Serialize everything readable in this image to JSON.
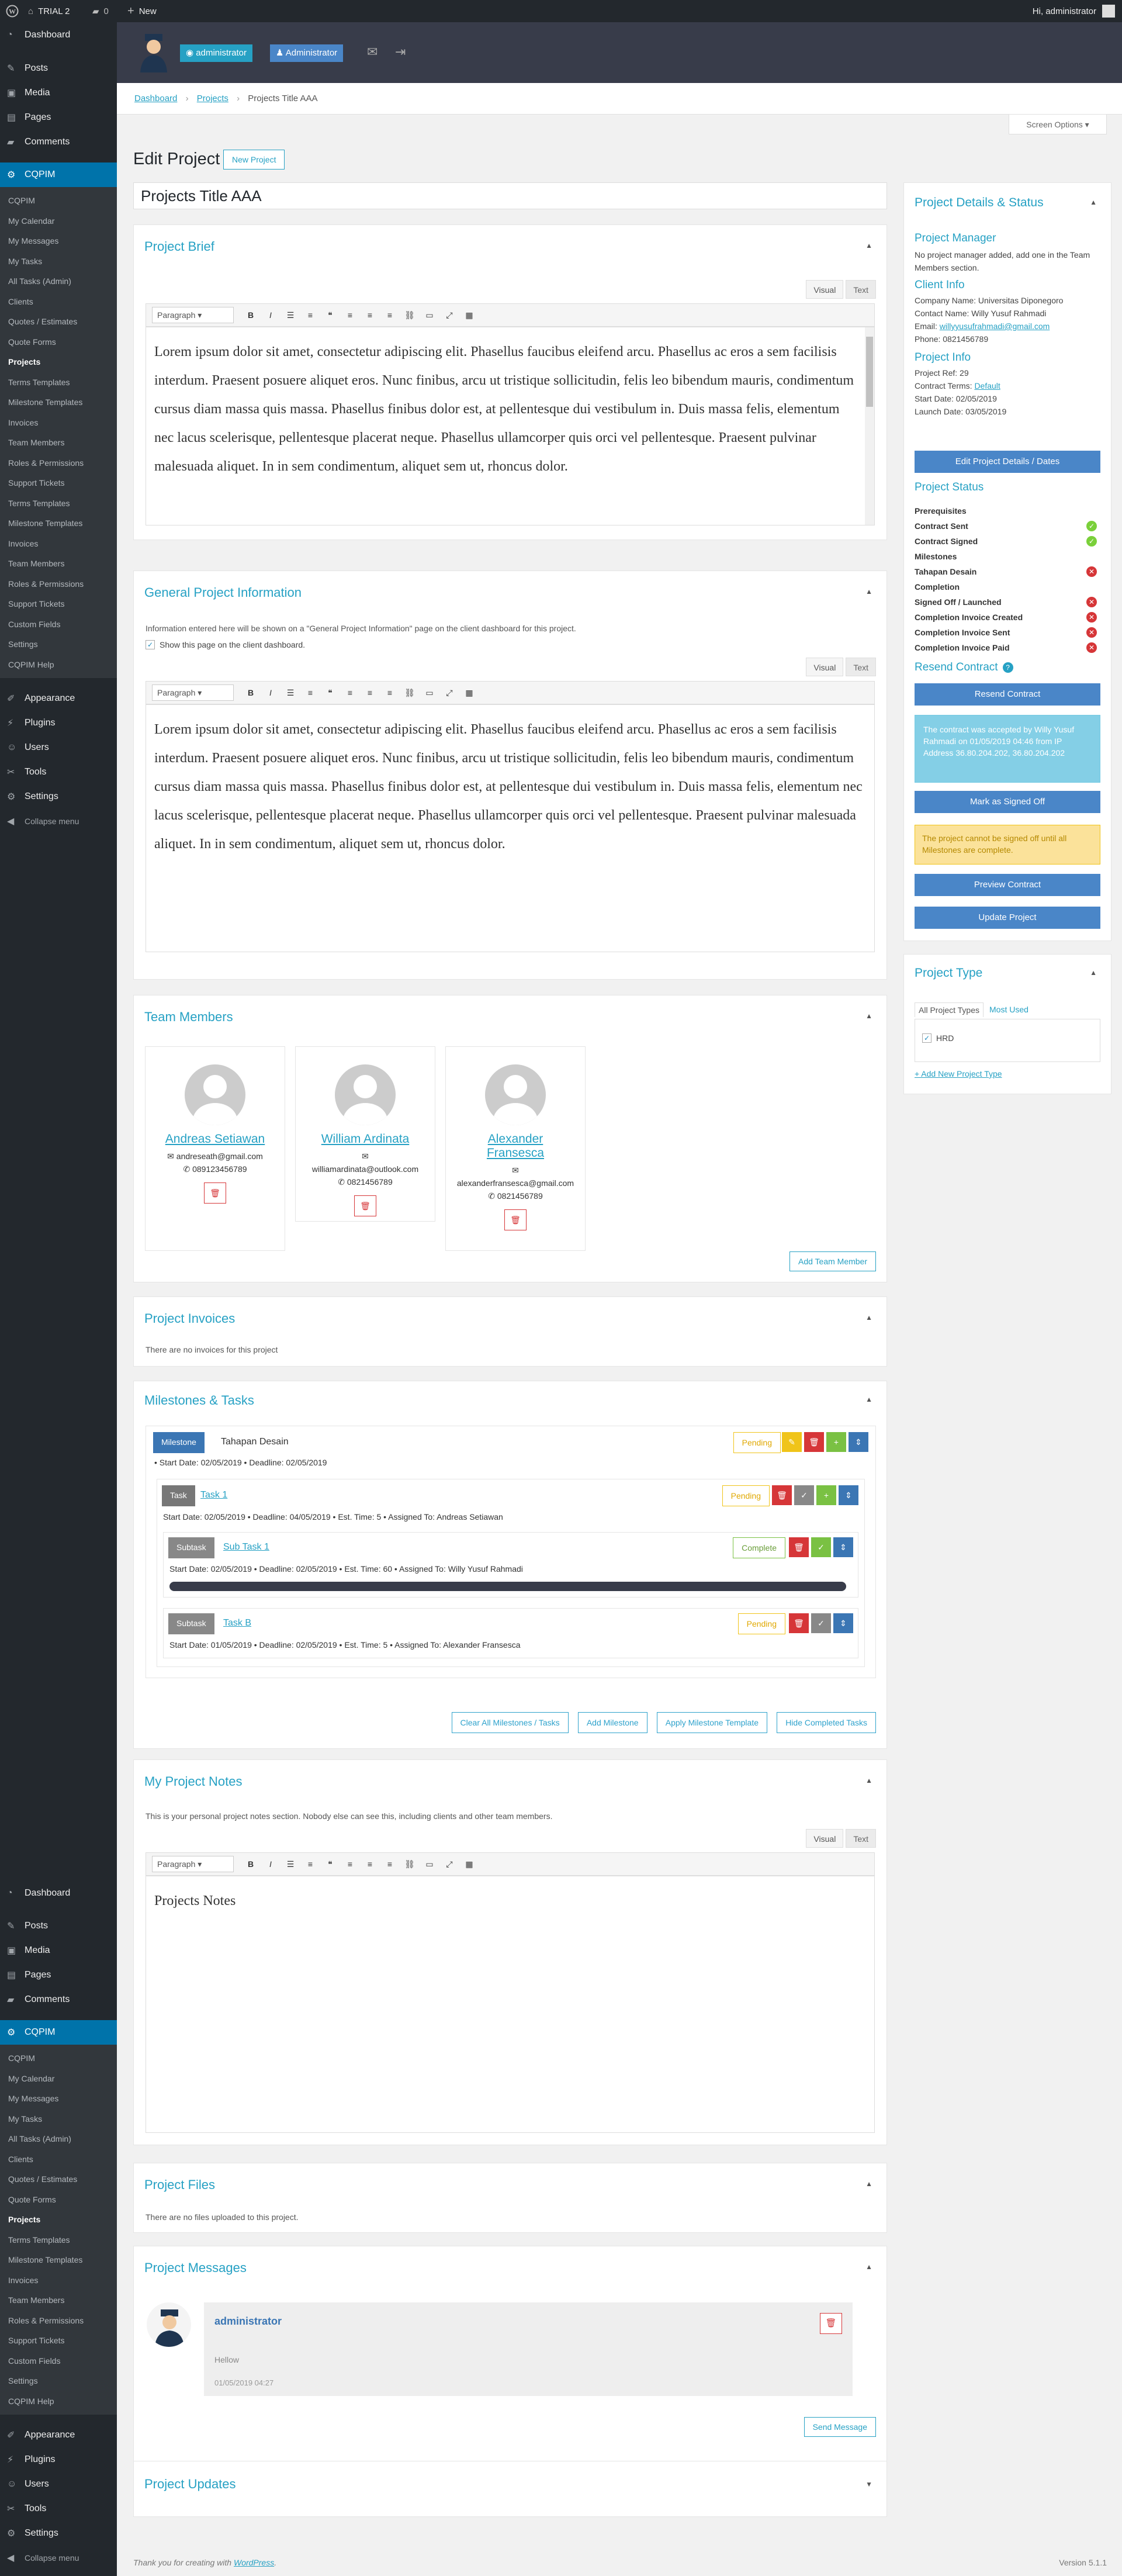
{
  "adminbar": {
    "site": "TRIAL 2",
    "comments": "0",
    "new": "New",
    "greeting": "Hi, administrator"
  },
  "menu": {
    "top": [
      {
        "label": "Dashboard",
        "icon": "dashboard-icon"
      }
    ],
    "group1": [
      {
        "label": "Posts",
        "icon": "pin-icon"
      },
      {
        "label": "Media",
        "icon": "media-icon"
      },
      {
        "label": "Pages",
        "icon": "pages-icon"
      },
      {
        "label": "Comments",
        "icon": "comments-icon"
      }
    ],
    "cqpim": "CQPIM",
    "sub": [
      "CQPIM",
      "My Calendar",
      "My Messages",
      "My Tasks",
      "All Tasks (Admin)",
      "Clients",
      "Quotes / Estimates",
      "Quote Forms",
      "Projects",
      "Terms Templates",
      "Milestone Templates",
      "Invoices",
      "Team Members",
      "Roles & Permissions",
      "Support Tickets",
      "Custom Fields",
      "Settings",
      "CQPIM Help"
    ],
    "flyout": [
      "Support Tickets",
      "Terms Templates",
      "Milestone Templates",
      "Invoices",
      "Team Members",
      "Roles & Permissions",
      "Support Tickets",
      "Custom Fields",
      "Settings",
      "CQPIM Help"
    ],
    "group2": [
      {
        "label": "Appearance",
        "icon": "brush-icon"
      },
      {
        "label": "Plugins",
        "icon": "plugin-icon"
      },
      {
        "label": "Users",
        "icon": "users-icon"
      },
      {
        "label": "Tools",
        "icon": "tools-icon"
      },
      {
        "label": "Settings",
        "icon": "settings-icon"
      }
    ],
    "collapse": "Collapse menu"
  },
  "header": {
    "role_badge": "administrator",
    "role_badge2": "Administrator"
  },
  "breadcrumb": {
    "home": "Dashboard",
    "section": "Projects",
    "current": "Projects Title AAA"
  },
  "screen_options": "Screen Options",
  "page": {
    "title": "Edit Project",
    "new_button": "New Project",
    "project_title": "Projects Title AAA"
  },
  "editor": {
    "visual": "Visual",
    "text": "Text",
    "format": "Paragraph"
  },
  "brief": {
    "heading": "Project Brief",
    "text": "Lorem ipsum dolor sit amet, consectetur adipiscing elit. Phasellus faucibus eleifend arcu. Phasellus ac eros a sem facilisis interdum. Praesent posuere aliquet eros. Nunc finibus, arcu ut tristique sollicitudin, felis leo bibendum mauris, condimentum cursus diam massa quis massa. Phasellus finibus dolor est, at pellentesque dui vestibulum in. Duis massa felis, elementum nec lacus scelerisque, pellentesque placerat neque. Phasellus ullamcorper quis orci vel pellentesque. Praesent pulvinar malesuada aliquet. In in sem condimentum, aliquet sem ut, rhoncus dolor."
  },
  "general": {
    "heading": "General Project Information",
    "note": "Information entered here will be shown on a \"General Project Information\" page on the client dashboard for this project.",
    "checkbox": "Show this page on the client dashboard.",
    "text": "Lorem ipsum dolor sit amet, consectetur adipiscing elit. Phasellus faucibus eleifend arcu. Phasellus ac eros a sem facilisis interdum. Praesent posuere aliquet eros. Nunc finibus, arcu ut tristique sollicitudin, felis leo bibendum mauris, condimentum cursus diam massa quis massa. Phasellus finibus dolor est, at pellentesque dui vestibulum in. Duis massa felis, elementum nec lacus scelerisque, pellentesque placerat neque. Phasellus ullamcorper quis orci vel pellentesque. Praesent pulvinar malesuada aliquet. In in sem condimentum, aliquet sem ut, rhoncus dolor."
  },
  "team": {
    "heading": "Team Members",
    "add": "Add Team Member",
    "members": [
      {
        "name": "Andreas Setiawan",
        "email": "andreseath@gmail.com",
        "phone": "089123456789"
      },
      {
        "name": "William Ardinata",
        "email": "williamardinata@outlook.com",
        "phone": "0821456789"
      },
      {
        "name": "Alexander Fransesca",
        "email": "alexanderfransesca@gmail.com",
        "phone": "0821456789"
      }
    ]
  },
  "invoices": {
    "heading": "Project Invoices",
    "empty": "There are no invoices for this project"
  },
  "milestones": {
    "heading": "Milestones & Tasks",
    "milestone_tag": "Milestone",
    "milestone_name": "Tahapan Desain",
    "milestone_status": "Pending",
    "milestone_meta": "Start Date: 02/05/2019  •  Deadline: 02/05/2019",
    "task_tag": "Task",
    "task_name": "Task 1",
    "task_status": "Pending",
    "task_meta": "Start Date: 02/05/2019  •  Deadline: 04/05/2019  •  Est. Time: 5  •  Assigned To: Andreas Setiawan",
    "subtask_tag": "Subtask",
    "subtask_name": "Sub Task 1",
    "subtask_status": "Complete",
    "subtask_meta": "Start Date: 02/05/2019  •  Deadline: 02/05/2019  •  Est. Time: 60  •  Assigned To: Willy Yusuf Rahmadi",
    "subtask_progress": 1.0,
    "subtask2_tag": "Subtask",
    "subtask2_name": "Task B",
    "subtask2_status": "Pending",
    "subtask2_meta": "Start Date: 01/05/2019  •  Deadline: 02/05/2019  •  Est. Time: 5  •  Assigned To: Alexander Fransesca",
    "buttons": [
      "Clear All Milestones / Tasks",
      "Add Milestone",
      "Apply Milestone Template",
      "Hide Completed Tasks"
    ]
  },
  "notes": {
    "heading": "My Project Notes",
    "note": "This is your personal project notes section. Nobody else can see this, including clients and other team members.",
    "text": "Projects Notes"
  },
  "files": {
    "heading": "Project Files",
    "empty": "There are no files uploaded to this project."
  },
  "messages": {
    "heading": "Project Messages",
    "author": "administrator",
    "body": "Hellow",
    "date": "01/05/2019 04:27",
    "send": "Send Message"
  },
  "updates": {
    "heading": "Project Updates"
  },
  "sidebar": {
    "heading": "Project Details & Status",
    "pm_h": "Project Manager",
    "pm_text": "No project manager added, add one in the Team Members section.",
    "client_h": "Client Info",
    "company": "Company Name: Universitas Diponegoro",
    "contact": "Contact Name: Willy Yusuf Rahmadi",
    "email_label": "Email:",
    "email": "willyyusufrahmadi@gmail.com",
    "phone": "Phone: 0821456789",
    "info_h": "Project Info",
    "ref": "Project Ref: 29",
    "terms_label": "Contract Terms:",
    "terms": "Default",
    "start": "Start Date: 02/05/2019",
    "launch": "Launch Date: 03/05/2019",
    "edit_btn": "Edit Project Details / Dates",
    "status_h": "Project Status",
    "status": [
      {
        "label": "Prerequisites",
        "state": "none"
      },
      {
        "label": "Contract Sent",
        "state": "ok"
      },
      {
        "label": "Contract Signed",
        "state": "ok"
      },
      {
        "label": "Milestones",
        "state": "none"
      },
      {
        "label": "Tahapan Desain",
        "state": "no"
      },
      {
        "label": "Completion",
        "state": "none"
      },
      {
        "label": "Signed Off / Launched",
        "state": "no"
      },
      {
        "label": "Completion Invoice Created",
        "state": "no"
      },
      {
        "label": "Completion Invoice Sent",
        "state": "no"
      },
      {
        "label": "Completion Invoice Paid",
        "state": "no"
      }
    ],
    "resend_h": "Resend Contract",
    "resend_btn": "Resend Contract",
    "accepted": "The contract was accepted by Willy Yusuf Rahmadi on 01/05/2019 04:46 from IP Address 36.80.204.202, 36.80.204.202",
    "signed_btn": "Mark as Signed Off",
    "warning": "The project cannot be signed off until all Milestones are complete.",
    "preview_btn": "Preview Contract",
    "update_btn": "Update Project"
  },
  "ptype": {
    "heading": "Project Type",
    "tab_all": "All Project Types",
    "tab_used": "Most Used",
    "item": "HRD",
    "add": "+ Add New Project Type"
  },
  "footer": {
    "thanks": "Thank you for creating with",
    "wp": "WordPress",
    "version": "Version 5.1.1"
  },
  "colors": {
    "accent": "#26a1c4",
    "admin_bar": "#23282d",
    "active_menu": "#0073aa",
    "button_blue": "#4a86c8",
    "danger": "#d63638",
    "success": "#7ad03a",
    "warning": "#f0c419"
  }
}
